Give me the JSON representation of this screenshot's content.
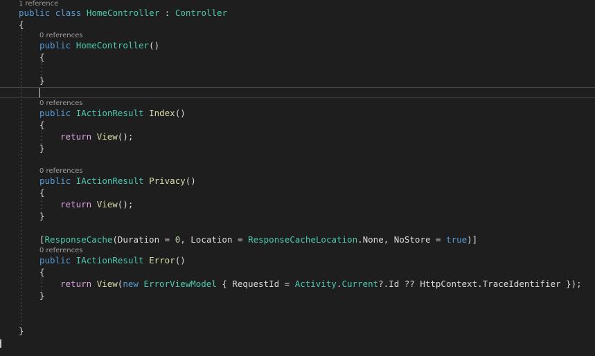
{
  "lens": {
    "class_refs": "1 reference",
    "ctor_refs": "0 references",
    "index_refs": "0 references",
    "privacy_refs": "0 references",
    "error_refs": "0 references"
  },
  "code": {
    "l1": [
      "public",
      "class",
      "HomeController",
      ":",
      "Controller"
    ],
    "l2": "{",
    "l3": [
      "public",
      "HomeController",
      "()"
    ],
    "l4": "{",
    "l5": "}",
    "l6": [
      "public",
      "IActionResult",
      "Index",
      "()"
    ],
    "l7": "{",
    "l8": [
      "return",
      "View",
      "();"
    ],
    "l9": "}",
    "l10": [
      "public",
      "IActionResult",
      "Privacy",
      "()"
    ],
    "l11": "{",
    "l12": [
      "return",
      "View",
      "();"
    ],
    "l13": "}",
    "l14": [
      "[",
      "ResponseCache",
      "(Duration = ",
      "0",
      ", Location = ",
      "ResponseCacheLocation",
      ".None, NoStore = ",
      "true",
      ")]"
    ],
    "l15": [
      "public",
      "IActionResult",
      "Error",
      "()"
    ],
    "l16": "{",
    "l17": [
      "return",
      "View",
      "(",
      "new",
      "ErrorViewModel",
      "{ RequestId = ",
      "Activity",
      ".",
      "Current",
      "?.Id ?? HttpContext.TraceIdentifier });"
    ],
    "l18": "}",
    "l19": "}"
  },
  "colors": {
    "background": "#1e1e1e",
    "keyword": "#569cd6",
    "control": "#d8a0df",
    "type": "#4ec9b0",
    "method": "#dcdcaa",
    "number": "#b5cea8",
    "text": "#dcdcdc",
    "codelens": "#9d9d9d"
  }
}
